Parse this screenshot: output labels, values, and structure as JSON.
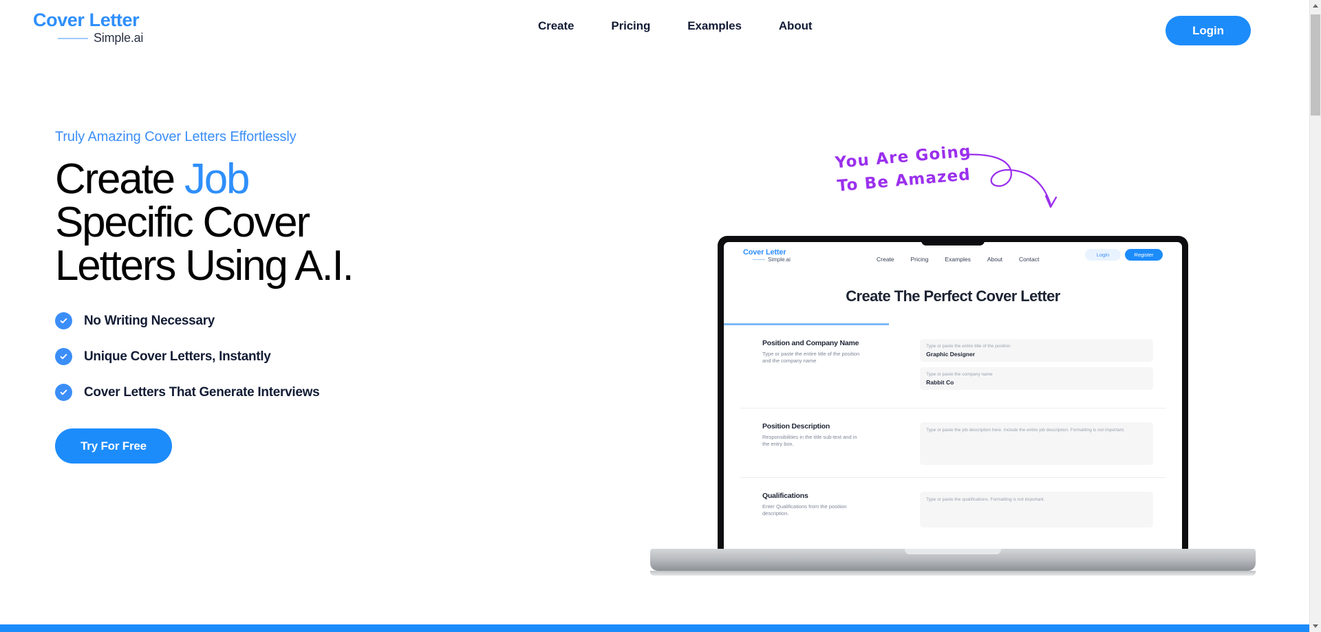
{
  "brand": {
    "name_top": "Cover Letter",
    "name_sub": "Simple.ai",
    "accent_color": "#2f8ffb"
  },
  "header": {
    "nav": [
      {
        "label": "Create"
      },
      {
        "label": "Pricing"
      },
      {
        "label": "Examples"
      },
      {
        "label": "About"
      }
    ],
    "login_label": "Login"
  },
  "hero": {
    "eyebrow": "Truly Amazing Cover Letters Effortlessly",
    "headline_line1_a": "Create",
    "headline_line1_accent": "Job",
    "headline_line2": "Specific Cover",
    "headline_line3": "Letters Using A.I.",
    "bullets": [
      {
        "label": "No Writing Necessary",
        "icon": "check-circle-icon"
      },
      {
        "label": "Unique Cover Letters, Instantly",
        "icon": "check-circle-icon"
      },
      {
        "label": "Cover Letters That Generate Interviews",
        "icon": "check-circle-icon"
      }
    ],
    "cta_label": "Try For Free",
    "doodle": {
      "line1": "You Are Going",
      "line2": "To Be Amazed",
      "color": "#9b30ed",
      "arrow_icon": "curly-arrow-down-icon"
    }
  },
  "laptop": {
    "screen": {
      "brand_top": "Cover Letter",
      "brand_sub": "Simple.ai",
      "nav": [
        {
          "label": "Create"
        },
        {
          "label": "Pricing"
        },
        {
          "label": "Examples"
        },
        {
          "label": "About"
        },
        {
          "label": "Contact"
        }
      ],
      "login_label": "Login",
      "register_label": "Register",
      "title": "Create The Perfect Cover Letter",
      "progress_percent": 36,
      "sections": [
        {
          "label": "Position and Company Name",
          "sub": "Type or paste the entire title of the position and the company name",
          "fields": [
            {
              "placeholder": "Type or paste the entire title of the position",
              "value": "Graphic Designer"
            },
            {
              "placeholder": "Type or paste the company name",
              "value": "Rabbit Co"
            }
          ]
        },
        {
          "label": "Position Description",
          "sub": "Responsibilities in the title sub-text and in the entry box.",
          "textarea_placeholder": "Type or paste the job description here. Include the entire job description. Formatting is not important."
        },
        {
          "label": "Qualifications",
          "sub": "Enter Qualifications from the position description.",
          "textarea_placeholder": "Type or paste the qualifications. Formatting is not important."
        }
      ]
    }
  },
  "colors": {
    "primary_blue": "#1d8cfb",
    "light_blue": "#3b8ef8",
    "purple": "#9b30ed",
    "dark_text": "#131c35"
  }
}
